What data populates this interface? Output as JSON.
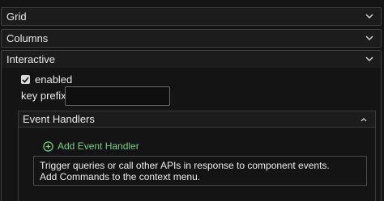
{
  "sections": {
    "grid": {
      "label": "Grid"
    },
    "columns": {
      "label": "Columns"
    },
    "interactive": {
      "label": "Interactive"
    }
  },
  "interactive": {
    "enabled": {
      "label": "enabled",
      "checked": true
    },
    "key_prefix": {
      "label": "key prefix",
      "value": ""
    },
    "event_handlers": {
      "label": "Event Handlers",
      "add_label": "Add Event Handler",
      "help_line1": "Trigger queries or call other APIs in response to component events.",
      "help_line2": "Add Commands to the context menu."
    }
  },
  "colors": {
    "accent_green": "#6fd08a",
    "panel_bg": "#1c1c1c",
    "border": "#3d3d3d"
  },
  "icons": {
    "section_chevron": "chevron-down-icon",
    "event_chevron": "chevron-up-icon",
    "add": "plus-circle-icon",
    "check": "checkmark-icon"
  }
}
